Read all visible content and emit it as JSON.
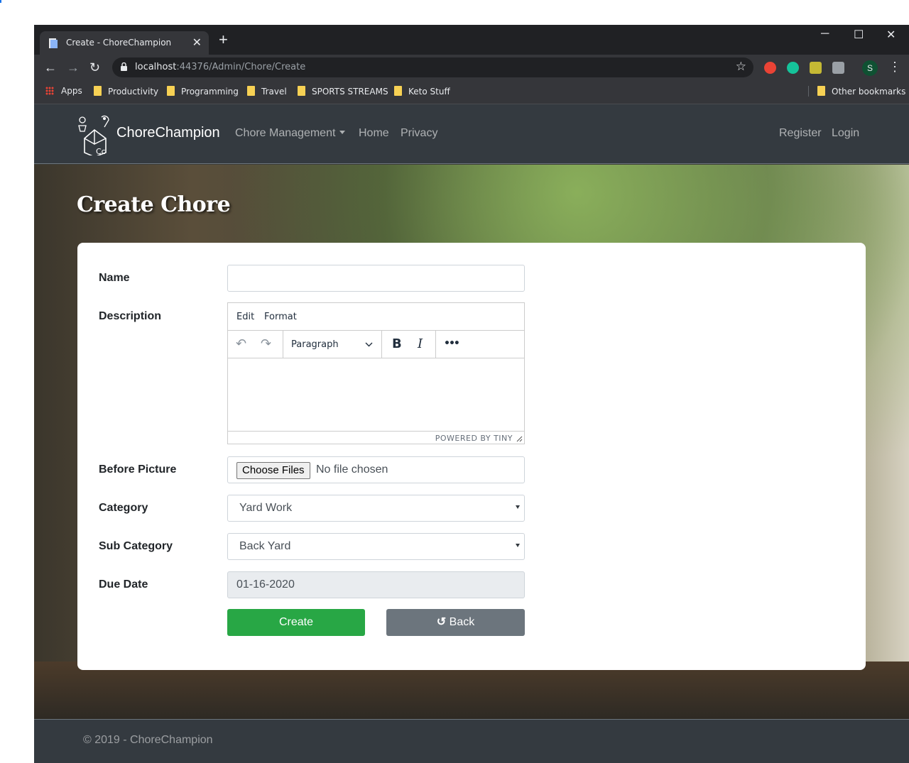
{
  "browser": {
    "tab_title": "Create - ChoreChampion",
    "tab_close": "✕",
    "new_tab": "+",
    "window_controls": {
      "minimize": "─",
      "maximize": "☐",
      "close": "✕"
    },
    "nav": {
      "back": "←",
      "forward": "→",
      "reload": "↻"
    },
    "url_host": "localhost",
    "url_path": ":44376/Admin/Chore/Create",
    "star": "☆",
    "profile_initial": "S",
    "menu": "⋮",
    "bookmarks": [
      {
        "label": "Apps",
        "icon": "apps-grid-icon"
      },
      {
        "label": "Productivity",
        "icon": "folder-icon"
      },
      {
        "label": "Programming",
        "icon": "folder-icon"
      },
      {
        "label": "Travel",
        "icon": "folder-icon"
      },
      {
        "label": "SPORTS STREAMS",
        "icon": "folder-icon"
      },
      {
        "label": "Keto Stuff",
        "icon": "folder-icon"
      }
    ],
    "other_bookmarks": "Other bookmarks"
  },
  "navbar": {
    "brand": "ChoreChampion",
    "links": [
      "Chore Management",
      "Home",
      "Privacy"
    ],
    "right_links": [
      "Register",
      "Login"
    ]
  },
  "page": {
    "title": "Create Chore"
  },
  "form": {
    "name_label": "Name",
    "name_value": "",
    "description_label": "Description",
    "editor": {
      "menu": [
        "Edit",
        "Format"
      ],
      "block_format": "Paragraph",
      "bold": "B",
      "italic": "I",
      "more": "•••",
      "undo": "↶",
      "redo": "↷",
      "powered_by": "POWERED BY TINY"
    },
    "before_picture_label": "Before Picture",
    "file_button": "Choose Files",
    "file_status": "No file chosen",
    "category_label": "Category",
    "category_value": "Yard Work",
    "subcategory_label": "Sub Category",
    "subcategory_value": "Back Yard",
    "due_date_label": "Due Date",
    "due_date_value": "01-16-2020",
    "create_button": "Create",
    "back_button": "Back",
    "back_icon": "↺"
  },
  "footer": {
    "text": "© 2019 - ChoreChampion"
  },
  "colors": {
    "navbar": "#343a40",
    "success": "#28a745",
    "secondary": "#6c757d",
    "browser_dark": "#202124",
    "browser_toolbar": "#35363a"
  }
}
